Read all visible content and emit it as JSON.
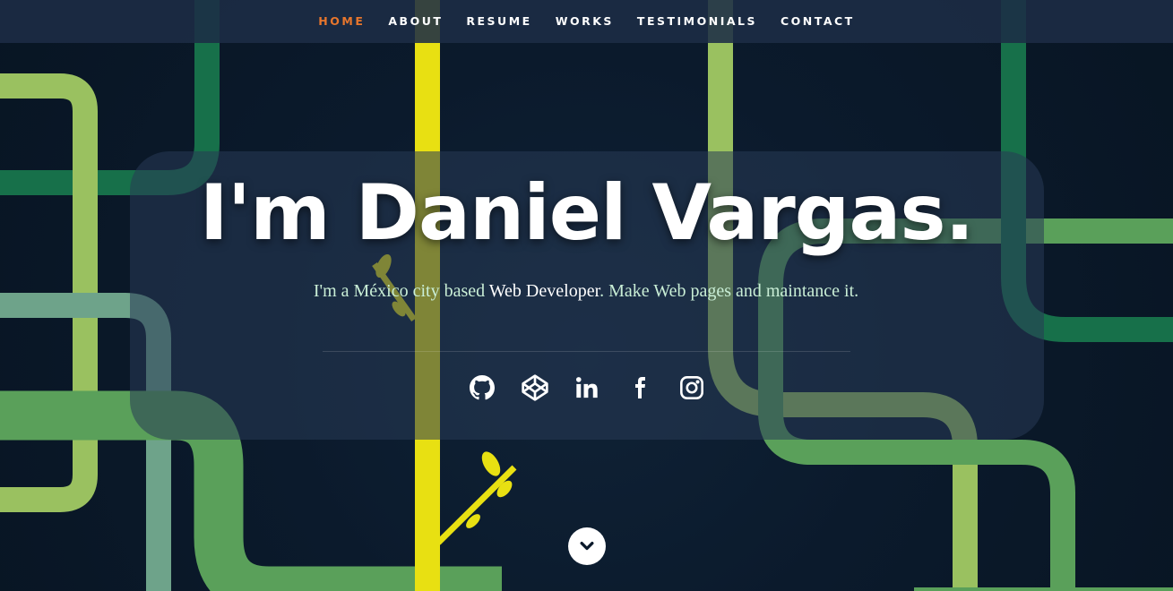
{
  "nav": {
    "items": [
      {
        "label": "HOME",
        "active": true
      },
      {
        "label": "ABOUT"
      },
      {
        "label": "RESUME"
      },
      {
        "label": "WORKS"
      },
      {
        "label": "TESTIMONIALS"
      },
      {
        "label": "CONTACT"
      }
    ]
  },
  "hero": {
    "title": "I'm Daniel Vargas.",
    "subtitle_part1": "I'm a México city based ",
    "subtitle_highlight": "Web Developer",
    "subtitle_part2": ". Make Web pages and maintance it."
  },
  "social": [
    {
      "name": "github-icon"
    },
    {
      "name": "codepen-icon"
    },
    {
      "name": "linkedin-icon"
    },
    {
      "name": "facebook-icon"
    },
    {
      "name": "instagram-icon"
    }
  ],
  "scroll": {
    "icon": "chevron-down-icon"
  },
  "colors": {
    "accent": "#e8762c",
    "background": "#0b1a2c",
    "text": "#ffffff",
    "subtitle": "#c9eed6"
  }
}
